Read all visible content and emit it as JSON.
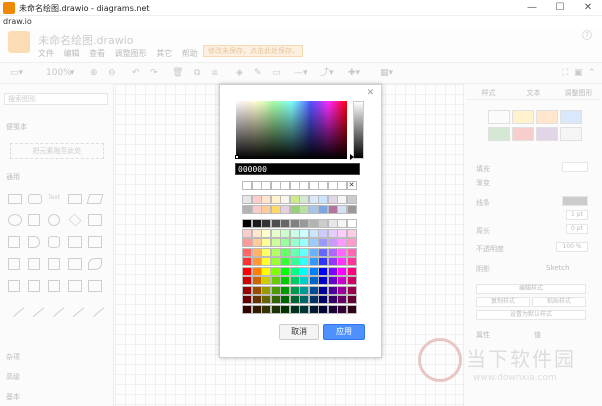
{
  "window": {
    "title": "未命名绘图.drawio - diagrams.net",
    "app_name": "draw.io",
    "minimize": "—",
    "maximize": "☐",
    "close": "✕"
  },
  "app": {
    "doc_title": "未命名绘图.drawio",
    "menus": [
      "文件",
      "编辑",
      "查看",
      "调整图形",
      "其它",
      "帮助"
    ],
    "unsaved_notice": "修改未保存，点击此处保存。",
    "toolbar": {
      "zoom": "100%"
    }
  },
  "sidebar": {
    "search_placeholder": "搜索图形",
    "scratchpad_label": "便笺本",
    "scratchpad_hint": "把元素拖至此处",
    "general_label": "通用",
    "misc_label": "杂项",
    "advanced_label": "高级",
    "basic_label": "基本"
  },
  "format_panel": {
    "tabs": [
      "样式",
      "文本",
      "调整图形"
    ],
    "fill_label": "填充",
    "gradient_label": "渐变",
    "line_label": "线条",
    "line_width": "1 pt",
    "perimeter_label": "周长",
    "perimeter_value": "0 pt",
    "opacity_label": "不透明度",
    "opacity_value": "100 %",
    "shadow_label": "阴影",
    "sketch_label": "Sketch",
    "edit_style": "编辑样式",
    "copy_style": "复制样式",
    "paste_style": "粘贴样式",
    "set_default": "设置为默认样式",
    "property_label": "属性",
    "value_label": "值",
    "swatch_colors": [
      "#ffffff",
      "#fff2cc",
      "#ffe6cc",
      "#dae8fc",
      "#d5e8d4",
      "#f8cecc",
      "#e1d5e7",
      "#f5f5f5"
    ]
  },
  "watermark": {
    "text": "当下软件园",
    "url": "www.downxia.com"
  },
  "color_dialog": {
    "close_label": "✕",
    "hex_value": "000000",
    "cancel_label": "取消",
    "apply_label": "应用",
    "recent_colors": [
      "#ffffff",
      "#ffffff",
      "#ffffff",
      "#ffffff",
      "#ffffff",
      "#ffffff",
      "#ffffff",
      "#ffffff",
      "#ffffff",
      "#ffffff",
      "#ffffff",
      "none"
    ],
    "preset_colors": [
      [
        "#e6e6e6",
        "#ffcccc",
        "#ffe6cc",
        "#fff2cc",
        "#f9f7ed",
        "#cdeb8b",
        "#d5e8d4",
        "#dae8fc",
        "#cce5ff",
        "#e1d5e7",
        "#f5f5f5",
        "#cccccc"
      ],
      [
        "#b3b3b3",
        "#f8cecc",
        "#ffcc99",
        "#ffd966",
        "#e6d0de",
        "#97d077",
        "#b9e0a5",
        "#a9c4eb",
        "#7ea6e0",
        "#b5739d",
        "#d4e1f5",
        "#999999"
      ]
    ],
    "palette_rows": [
      [
        "#000000",
        "#1a1a1a",
        "#333333",
        "#4d4d4d",
        "#666666",
        "#808080",
        "#999999",
        "#b3b3b3",
        "#cccccc",
        "#e6e6e6",
        "#f5f5f5",
        "#ffffff"
      ],
      [
        "#ffcccc",
        "#ffe6cc",
        "#ffffcc",
        "#e6ffcc",
        "#ccffcc",
        "#ccffe6",
        "#ccffff",
        "#cce5ff",
        "#ccccff",
        "#e5ccff",
        "#ffccff",
        "#ffcce6"
      ],
      [
        "#ff9999",
        "#ffcc99",
        "#ffff99",
        "#ccff99",
        "#99ff99",
        "#99ffcc",
        "#99ffff",
        "#99ccff",
        "#9999ff",
        "#cc99ff",
        "#ff99ff",
        "#ff99cc"
      ],
      [
        "#ff6666",
        "#ffb366",
        "#ffff66",
        "#b3ff66",
        "#66ff66",
        "#66ffb3",
        "#66ffff",
        "#66b2ff",
        "#6666ff",
        "#b266ff",
        "#ff66ff",
        "#ff66b3"
      ],
      [
        "#ff3333",
        "#ff9933",
        "#ffff33",
        "#99ff33",
        "#33ff33",
        "#33ff99",
        "#33ffff",
        "#3399ff",
        "#3333ff",
        "#9933ff",
        "#ff33ff",
        "#ff3399"
      ],
      [
        "#ff0000",
        "#ff8000",
        "#ffff00",
        "#80ff00",
        "#00ff00",
        "#00ff80",
        "#00ffff",
        "#007fff",
        "#0000ff",
        "#7f00ff",
        "#ff00ff",
        "#ff0080"
      ],
      [
        "#cc0000",
        "#cc6600",
        "#cccc00",
        "#66cc00",
        "#00cc00",
        "#00cc66",
        "#00cccc",
        "#0066cc",
        "#0000cc",
        "#6600cc",
        "#cc00cc",
        "#cc0066"
      ],
      [
        "#990000",
        "#994c00",
        "#999900",
        "#4d9900",
        "#009900",
        "#00994d",
        "#009999",
        "#004c99",
        "#000099",
        "#4c0099",
        "#990099",
        "#99004d"
      ],
      [
        "#660000",
        "#663300",
        "#666600",
        "#336600",
        "#006600",
        "#006633",
        "#006666",
        "#003366",
        "#000066",
        "#330066",
        "#660066",
        "#660033"
      ],
      [
        "#330000",
        "#331a00",
        "#333300",
        "#1a3300",
        "#003300",
        "#00331a",
        "#003333",
        "#001933",
        "#000033",
        "#190033",
        "#330033",
        "#33001a"
      ]
    ]
  }
}
